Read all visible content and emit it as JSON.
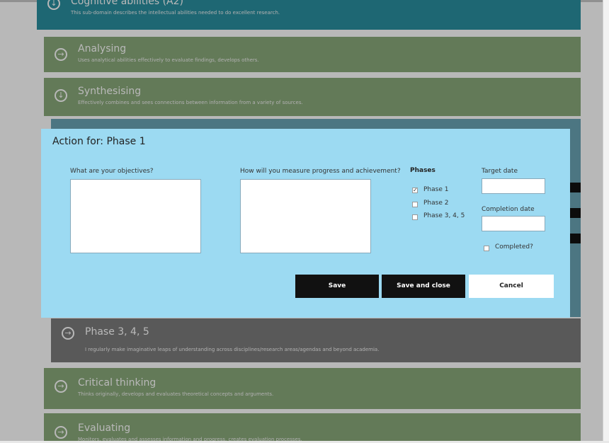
{
  "list": {
    "top_row": {
      "title": "Cognitive abilities (A2)",
      "desc": "This sub-domain describes the intellectual abilities needed to do excellent research."
    },
    "analysing": {
      "title": "Analysing",
      "desc": "Uses analytical abilities effectively to evaluate findings, develops others."
    },
    "synthesising": {
      "title": "Synthesising",
      "desc": "Effectively combines and sees connections between information from a variety of sources."
    },
    "phase345": {
      "title": "Phase 3, 4, 5",
      "desc": "I regularly make imaginative leaps of understanding across disciplines/research areas/agendas and beyond academia."
    },
    "critical": {
      "title": "Critical thinking",
      "desc": "Thinks originally, develops and evaluates theoretical concepts and arguments."
    },
    "evaluating": {
      "title": "Evaluating",
      "desc": "Monitors, evaluates and assesses information and progress, creates evaluation processes."
    }
  },
  "modal": {
    "title": "Action for: Phase 1",
    "objectives_label": "What are your objectives?",
    "measure_label": "How will you measure progress and achievement?",
    "phases_label": "Phases",
    "phases": [
      {
        "label": "Phase 1",
        "checked": true
      },
      {
        "label": "Phase 2",
        "checked": false
      },
      {
        "label": "Phase 3, 4, 5",
        "checked": false
      }
    ],
    "target_date_label": "Target date",
    "completion_date_label": "Completion date",
    "completed_label": "Completed?",
    "save_label": "Save",
    "save_close_label": "Save and close",
    "cancel_label": "Cancel"
  },
  "colors": {
    "modal_bg": "#9cdaf2",
    "row_green": "#8aa97a",
    "row_teal": "#2a8fa0",
    "button_dark": "#111111"
  }
}
